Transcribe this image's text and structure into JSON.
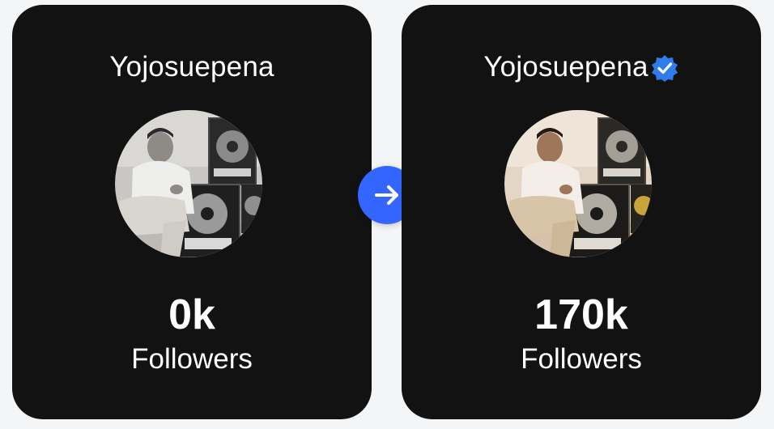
{
  "before": {
    "username": "Yojosuepena",
    "verified": false,
    "followers_count": "0k",
    "followers_label": "Followers",
    "avatar_icon": "profile-photo-grayscale"
  },
  "after": {
    "username": "Yojosuepena",
    "verified": true,
    "followers_count": "170k",
    "followers_label": "Followers",
    "avatar_icon": "profile-photo-color"
  },
  "transition": {
    "icon": "arrow-right-icon"
  },
  "colors": {
    "card_background": "#121212",
    "page_background": "#f4f5f7",
    "accent": "#3366ff",
    "verified_badge": "#2f7dea",
    "text": "#ffffff"
  }
}
